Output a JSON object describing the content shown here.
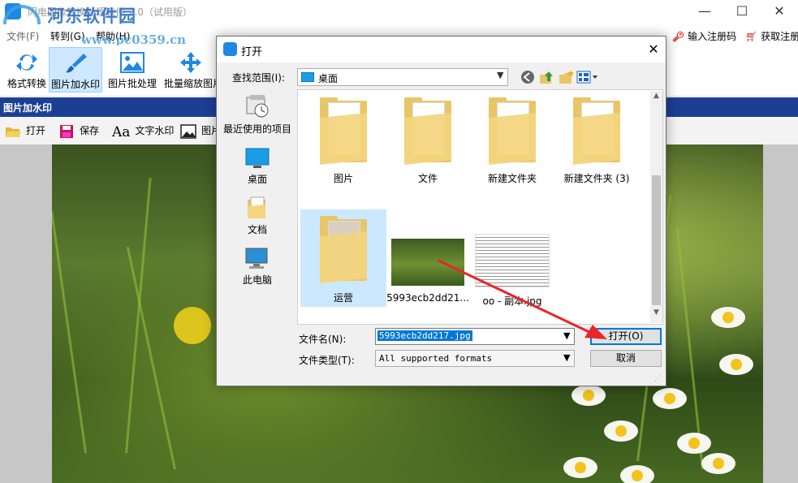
{
  "app": {
    "title": "闪电图像转换处理软件 2.0（试用版）",
    "watermark_site": "河东软件园",
    "watermark_url": "www.pc0359.cn",
    "window_controls": [
      "—",
      "☐",
      "✕"
    ]
  },
  "menubar": {
    "items": [
      "文件(F)",
      "转到(G)",
      "帮助(H)"
    ],
    "register_input": "输入注册码",
    "register_get": "获取注册"
  },
  "toolbar": {
    "items": [
      "格式转换",
      "图片加水印",
      "图片批处理",
      "批量缩放图片"
    ]
  },
  "panel": {
    "title": "图片加水印",
    "actions": [
      "打开",
      "保存",
      "文字水印",
      "图片"
    ]
  },
  "dialog": {
    "title": "打开",
    "lookin_label": "查找范围(I):",
    "lookin_value": "桌面",
    "places": [
      "最近使用的项目",
      "桌面",
      "文档",
      "此电脑"
    ],
    "files": [
      {
        "name": "图片",
        "kind": "folder"
      },
      {
        "name": "文件",
        "kind": "folder"
      },
      {
        "name": "新建文件夹",
        "kind": "folder"
      },
      {
        "name": "新建文件夹 (3)",
        "kind": "folder"
      },
      {
        "name": "运营",
        "kind": "folder",
        "selected": true
      },
      {
        "name": "5993ecb2dd21...",
        "kind": "image"
      },
      {
        "name": "oo - 副本.jpg",
        "kind": "image"
      }
    ],
    "filename_label": "文件名(N):",
    "filename_value": "5993ecb2dd217.jpg",
    "filetype_label": "文件类型(T):",
    "filetype_value": "All supported formats",
    "open_button": "打开(O)",
    "cancel_button": "取消"
  },
  "colors": {
    "panel_header": "#1c3f94",
    "selection": "#cce8ff",
    "accent": "#0078d7",
    "annotation_arrow": "#e8262b"
  }
}
